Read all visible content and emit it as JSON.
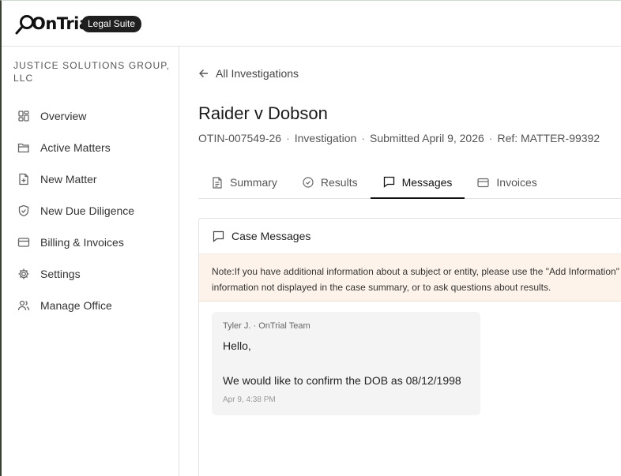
{
  "header": {
    "logo_text": "OnTrial",
    "badge": "Legal Suite"
  },
  "sidebar": {
    "org_name": "JUSTICE SOLUTIONS GROUP, LLC",
    "items": [
      {
        "label": "Overview",
        "icon": "grid-icon"
      },
      {
        "label": "Active Matters",
        "icon": "folder-icon"
      },
      {
        "label": "New Matter",
        "icon": "file-plus-icon"
      },
      {
        "label": "New Due Diligence",
        "icon": "shield-check-icon"
      },
      {
        "label": "Billing & Invoices",
        "icon": "credit-card-icon"
      },
      {
        "label": "Settings",
        "icon": "gear-icon"
      },
      {
        "label": "Manage Office",
        "icon": "users-icon"
      }
    ]
  },
  "main": {
    "back_label": "All Investigations",
    "title": "Raider v Dobson",
    "meta": {
      "id": "OTIN-007549-26",
      "type": "Investigation",
      "submitted": "Submitted April 9, 2026",
      "ref": "Ref: MATTER-99392"
    },
    "tabs": [
      {
        "label": "Summary",
        "icon": "document-icon",
        "active": false
      },
      {
        "label": "Results",
        "icon": "check-circle-icon",
        "active": false
      },
      {
        "label": "Messages",
        "icon": "message-icon",
        "active": true
      },
      {
        "label": "Invoices",
        "icon": "credit-card-icon",
        "active": false
      }
    ],
    "card": {
      "title": "Case Messages",
      "note_prefix": "Note:",
      "note_line1": "If you have additional information about a subject or entity, please use the \"Add Information\"",
      "note_line2": "information not displayed in the case summary, or to ask questions about results.",
      "messages": [
        {
          "author": "Tyler J. · OnTrial Team",
          "line1": "Hello,",
          "line2": "We would like to confirm the DOB as 08/12/1998",
          "time": "Apr 9, 4:38 PM"
        }
      ]
    }
  }
}
